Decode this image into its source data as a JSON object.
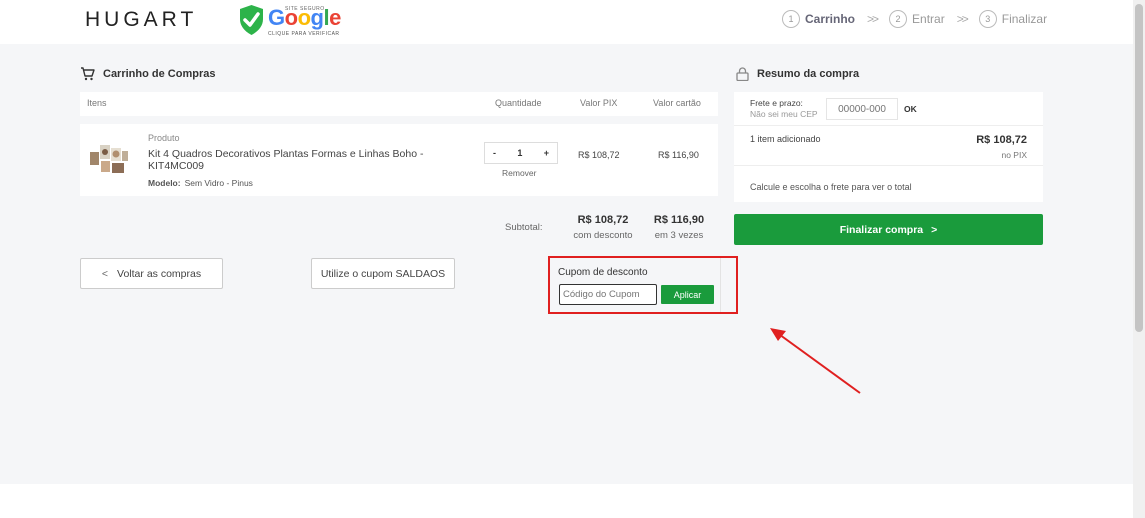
{
  "header": {
    "logo": "HUGART",
    "seal": {
      "top_text": "SITE SEGURO",
      "brand": "Google",
      "bottom_text": "CLIQUE PARA VERIFICAR"
    },
    "steps": [
      {
        "num": "1",
        "label": "Carrinho",
        "active": true
      },
      {
        "num": "2",
        "label": "Entrar",
        "active": false
      },
      {
        "num": "3",
        "label": "Finalizar",
        "active": false
      }
    ]
  },
  "cart": {
    "title": "Carrinho de Compras",
    "columns": {
      "items": "Itens",
      "quantity": "Quantidade",
      "pix": "Valor PIX",
      "card": "Valor cartão"
    },
    "product": {
      "kicker": "Produto",
      "name": "Kit 4 Quadros Decorativos Plantas Formas e Linhas Boho - KIT4MC009",
      "model_label": "Modelo:",
      "model_value": "Sem Vidro - Pinus",
      "qty_minus": "-",
      "qty": "1",
      "qty_plus": "+",
      "remove": "Remover",
      "price_pix": "R$ 108,72",
      "price_card": "R$ 116,90"
    },
    "subtotal": {
      "label": "Subtotal:",
      "pix_value": "R$ 108,72",
      "pix_note": "com desconto",
      "card_value": "R$ 116,90",
      "card_note": "em 3 vezes"
    },
    "back_button": "Voltar as compras",
    "coupon_hint_button": "Utilize o cupom SALDAOS",
    "coupon": {
      "label": "Cupom de desconto",
      "placeholder": "Código do Cupom",
      "apply": "Aplicar"
    }
  },
  "summary": {
    "title": "Resumo da compra",
    "freight_label": "Frete e prazo:",
    "freight_link": "Não sei meu CEP",
    "cep_placeholder": "00000-000",
    "cep_ok": "OK",
    "items_added": "1 item adicionado",
    "total": "R$ 108,72",
    "total_note": "no PIX",
    "calc_note": "Calcule e escolha o frete para ver o total",
    "finalize": "Finalizar compra"
  },
  "colors": {
    "green": "#1a9b3c",
    "highlight": "#e02020"
  }
}
